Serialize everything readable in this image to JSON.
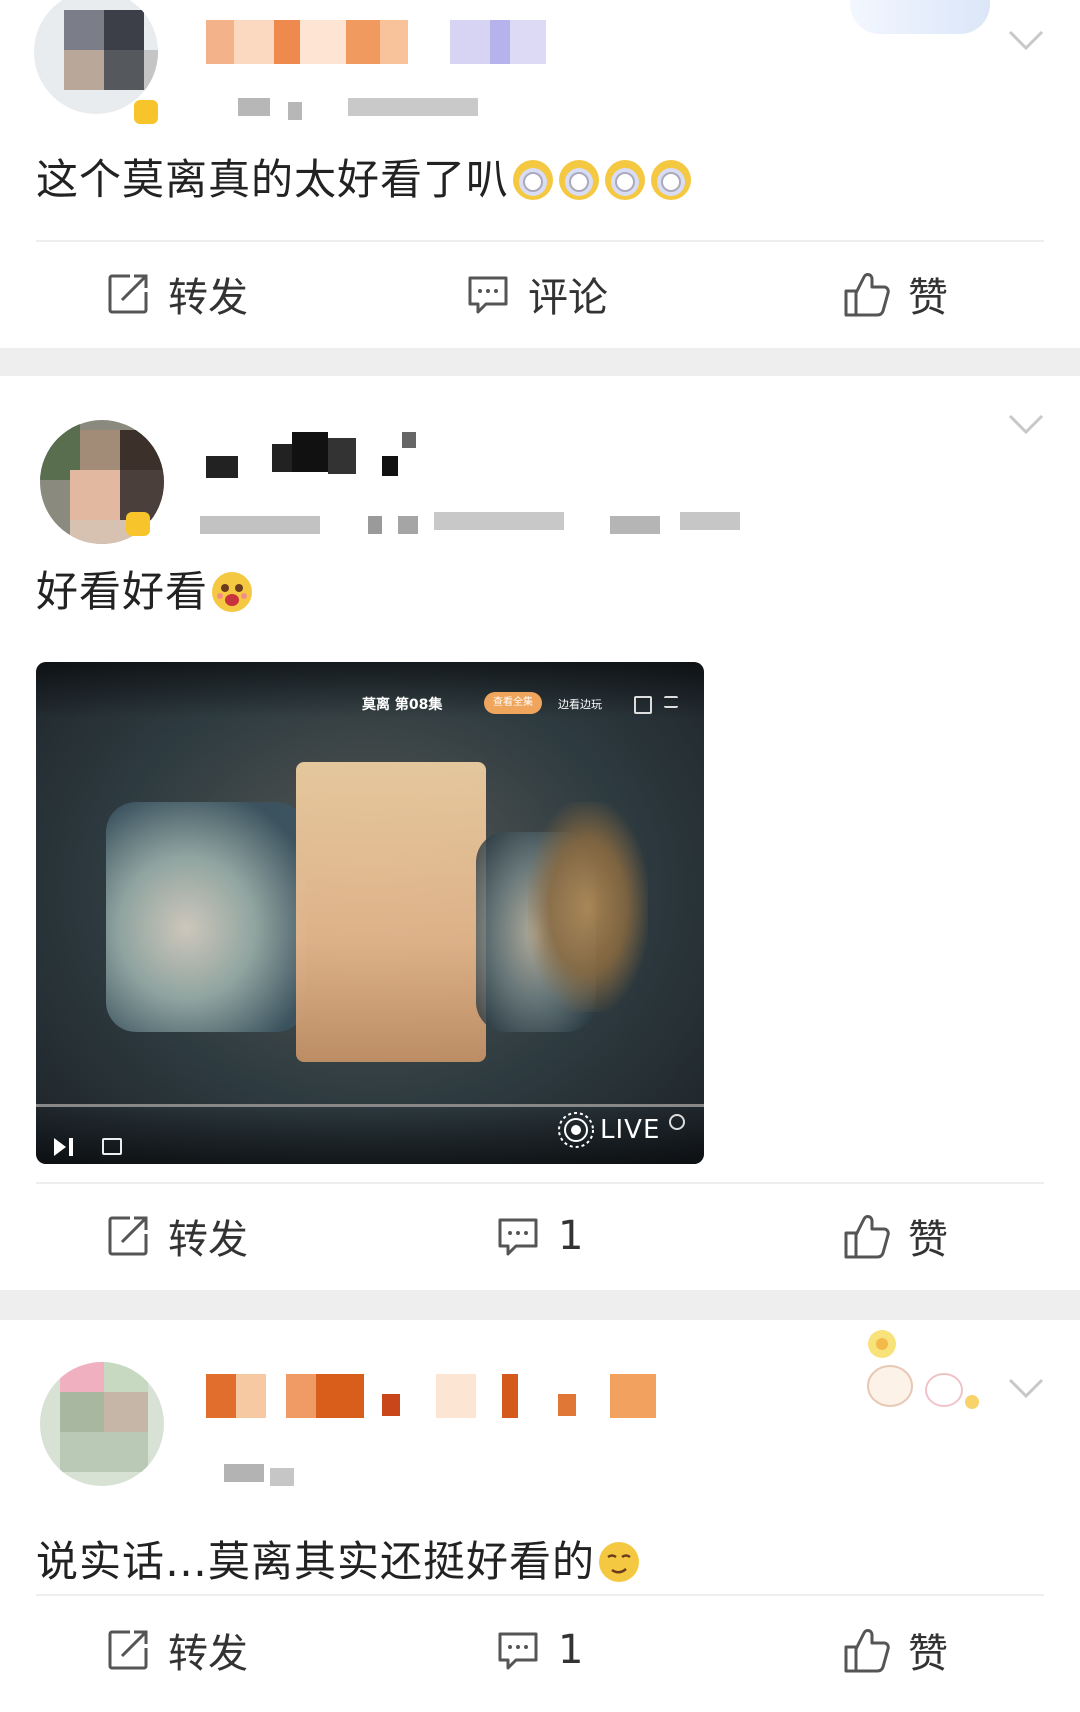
{
  "posts": [
    {
      "text": "这个莫离真的太好看了叭",
      "actions": {
        "repost": "转发",
        "comment": "评论",
        "like": "赞"
      }
    },
    {
      "text": "好看好看",
      "video": {
        "title": "莫离 第08集",
        "pill": "查看全集",
        "side": "边看边玩",
        "live": "LIVE"
      },
      "actions": {
        "repost": "转发",
        "comment": "1",
        "like": "赞"
      }
    },
    {
      "text": "说实话…莫离其实还挺好看的",
      "actions": {
        "repost": "转发",
        "comment": "1",
        "like": "赞"
      }
    }
  ],
  "icons": [
    "share-icon",
    "comment-icon",
    "thumbs-up-icon",
    "chevron-down-icon",
    "live-icon",
    "play-pause-icon"
  ],
  "colors": {
    "separator": "#eeeeee",
    "text": "#222222",
    "action_text": "#333333"
  }
}
